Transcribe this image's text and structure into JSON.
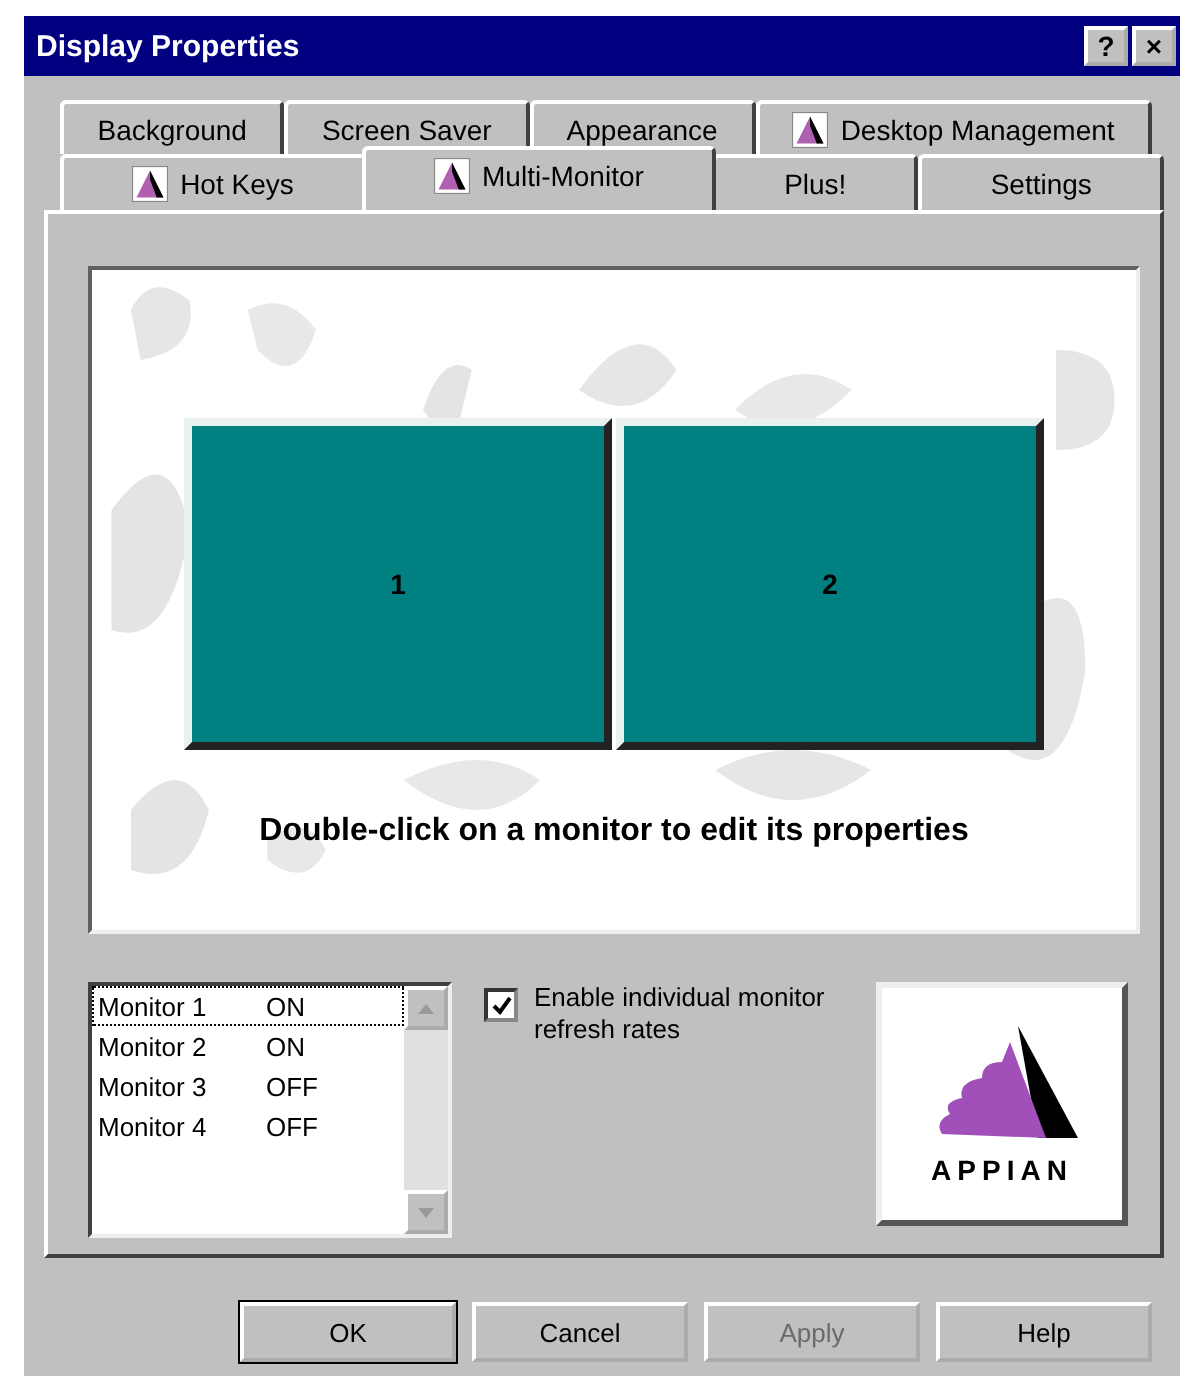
{
  "window": {
    "title": "Display Properties",
    "help_button": "?",
    "close_button": "×"
  },
  "tab_rows": [
    [
      {
        "label": "Background",
        "selected": false,
        "icon": false
      },
      {
        "label": "Screen Saver",
        "selected": false,
        "icon": false
      },
      {
        "label": "Appearance",
        "selected": false,
        "icon": false
      },
      {
        "label": "Desktop Management",
        "selected": false,
        "icon": true
      }
    ],
    [
      {
        "label": "Hot Keys",
        "selected": false,
        "icon": true
      },
      {
        "label": "Multi-Monitor",
        "selected": true,
        "icon": true
      },
      {
        "label": "Plus!",
        "selected": false,
        "icon": false
      },
      {
        "label": "Settings",
        "selected": false,
        "icon": false
      }
    ]
  ],
  "preview": {
    "monitors": [
      {
        "label": "1"
      },
      {
        "label": "2"
      }
    ],
    "hint": "Double-click on a monitor to edit its properties"
  },
  "monitor_list": [
    {
      "name": "Monitor 1",
      "status": "ON",
      "selected": true
    },
    {
      "name": "Monitor 2",
      "status": "ON",
      "selected": false
    },
    {
      "name": "Monitor 3",
      "status": "OFF",
      "selected": false
    },
    {
      "name": "Monitor 4",
      "status": "OFF",
      "selected": false
    }
  ],
  "refresh_option": {
    "label": "Enable individual monitor refresh rates",
    "checked": true
  },
  "logo": {
    "text": "APPIAN"
  },
  "buttons": [
    {
      "label": "OK",
      "disabled": false,
      "default": true
    },
    {
      "label": "Cancel",
      "disabled": false,
      "default": false
    },
    {
      "label": "Apply",
      "disabled": true,
      "default": false
    },
    {
      "label": "Help",
      "disabled": false,
      "default": false
    }
  ]
}
